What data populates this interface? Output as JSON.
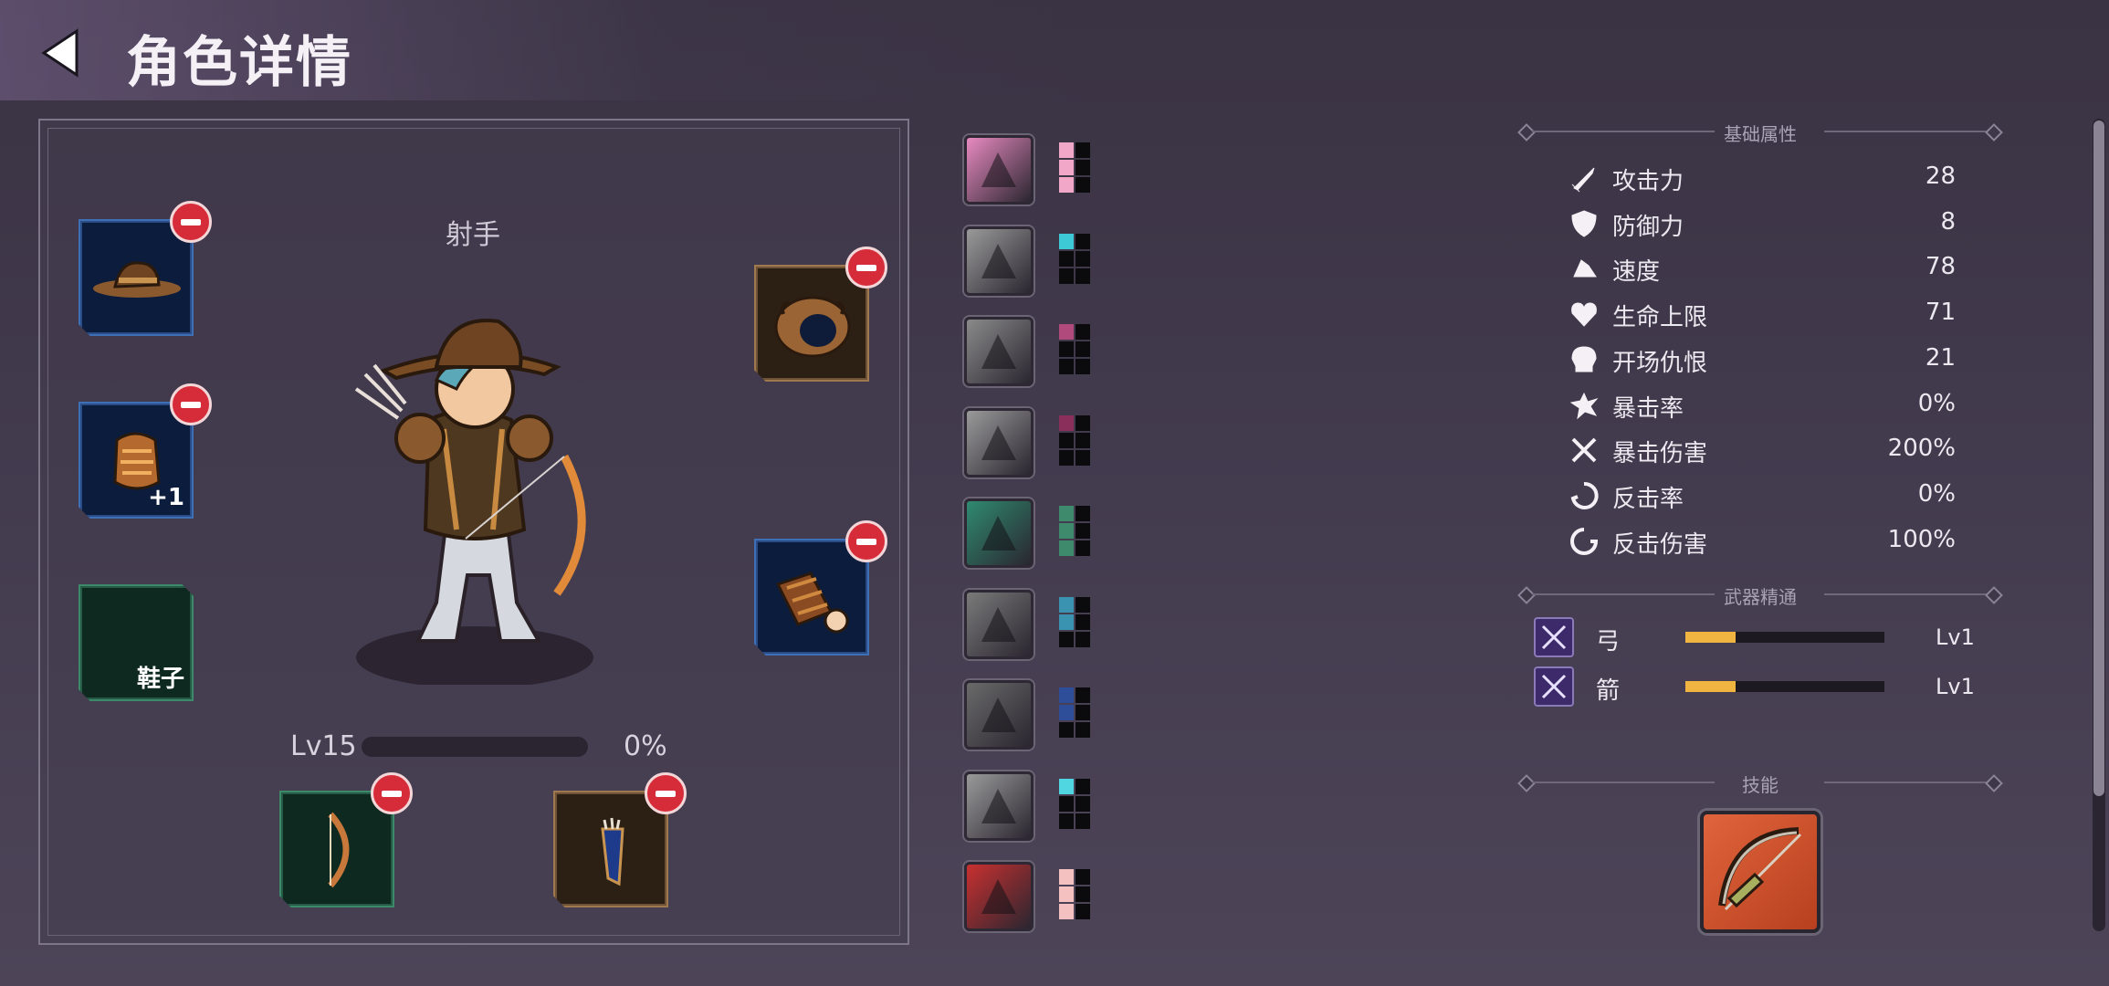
{
  "header": {
    "title": "角色详情"
  },
  "character": {
    "class_name": "射手",
    "level": "Lv15",
    "xp_percent_label": "0%",
    "xp_fraction": 0.0,
    "slots": [
      {
        "id": "hat",
        "bg": "blue",
        "label": "",
        "removable": true
      },
      {
        "id": "armor",
        "bg": "blue",
        "label": "+1",
        "removable": true
      },
      {
        "id": "shoes",
        "bg": "green",
        "label": "鞋子",
        "removable": false
      },
      {
        "id": "pouch",
        "bg": "brown",
        "label": "",
        "removable": true
      },
      {
        "id": "bracer",
        "bg": "blue",
        "label": "",
        "removable": true
      },
      {
        "id": "bow",
        "bg": "green",
        "label": "",
        "removable": true
      },
      {
        "id": "quiver",
        "bg": "brown",
        "label": "",
        "removable": true
      }
    ]
  },
  "skills": [
    {
      "icon": "boots-skill-icon",
      "color": "#e88ac0",
      "pips": [
        "#f1a7c8",
        "#0b0a0d",
        "#f1a7c8",
        "#0b0a0d",
        "#f1a7c8",
        "#0b0a0d"
      ]
    },
    {
      "icon": "slash-skill-icon",
      "color": "#9a9a9a",
      "pips": [
        "#3ec9d6",
        "#0b0a0d",
        "#0b0a0d",
        "#0b0a0d",
        "#0b0a0d",
        "#0b0a0d"
      ]
    },
    {
      "icon": "claw-skill-icon",
      "color": "#8a8a8a",
      "pips": [
        "#b04a7c",
        "#0b0a0d",
        "#0b0a0d",
        "#0b0a0d",
        "#0b0a0d",
        "#0b0a0d"
      ]
    },
    {
      "icon": "arrows-skill-icon",
      "color": "#9a9a9a",
      "pips": [
        "#8a2f5c",
        "#0b0a0d",
        "#0b0a0d",
        "#0b0a0d",
        "#0b0a0d",
        "#0b0a0d"
      ]
    },
    {
      "icon": "crossbow-skill-icon",
      "color": "#2f8a70",
      "pips": [
        "#3d8a6c",
        "#0b0a0d",
        "#3d8a6c",
        "#0b0a0d",
        "#3d8a6c",
        "#0b0a0d"
      ]
    },
    {
      "icon": "beast-skill-icon",
      "color": "#7a7a7a",
      "pips": [
        "#3a93b0",
        "#0b0a0d",
        "#3a93b0",
        "#0b0a0d",
        "#0b0a0d",
        "#0b0a0d"
      ]
    },
    {
      "icon": "shadow-skill-icon",
      "color": "#6a6a6a",
      "pips": [
        "#2f4e9a",
        "#0b0a0d",
        "#2f4e9a",
        "#0b0a0d",
        "#0b0a0d",
        "#0b0a0d"
      ]
    },
    {
      "icon": "ghost-skill-icon",
      "color": "#9a9a9a",
      "pips": [
        "#4fd6e0",
        "#0b0a0d",
        "#0b0a0d",
        "#0b0a0d",
        "#0b0a0d",
        "#0b0a0d"
      ]
    },
    {
      "icon": "swords-skill-icon",
      "color": "#c83030",
      "pips": [
        "#f4c0c0",
        "#0b0a0d",
        "#f4c0c0",
        "#0b0a0d",
        "#f4c0c0",
        "#0b0a0d"
      ]
    }
  ],
  "stats_panel": {
    "base_title": "基础属性",
    "stats": [
      {
        "icon": "sword-icon",
        "name": "攻击力",
        "value": "28"
      },
      {
        "icon": "shield-icon",
        "name": "防御力",
        "value": "8"
      },
      {
        "icon": "boot-wing-icon",
        "name": "速度",
        "value": "78"
      },
      {
        "icon": "heart-icon",
        "name": "生命上限",
        "value": "71"
      },
      {
        "icon": "skull-icon",
        "name": "开场仇恨",
        "value": "21"
      },
      {
        "icon": "burst-icon",
        "name": "暴击率",
        "value": "0%"
      },
      {
        "icon": "crossed-swords-icon",
        "name": "暴击伤害",
        "value": "200%"
      },
      {
        "icon": "counter-icon",
        "name": "反击率",
        "value": "0%"
      },
      {
        "icon": "counter-damage-icon",
        "name": "反击伤害",
        "value": "100%"
      }
    ],
    "mastery_title": "武器精通",
    "mastery": [
      {
        "icon": "bow-mastery-icon",
        "name": "弓",
        "level": "Lv1",
        "progress": 0.25
      },
      {
        "icon": "arrow-mastery-icon",
        "name": "箭",
        "level": "Lv1",
        "progress": 0.25
      }
    ],
    "skill_title": "技能"
  }
}
